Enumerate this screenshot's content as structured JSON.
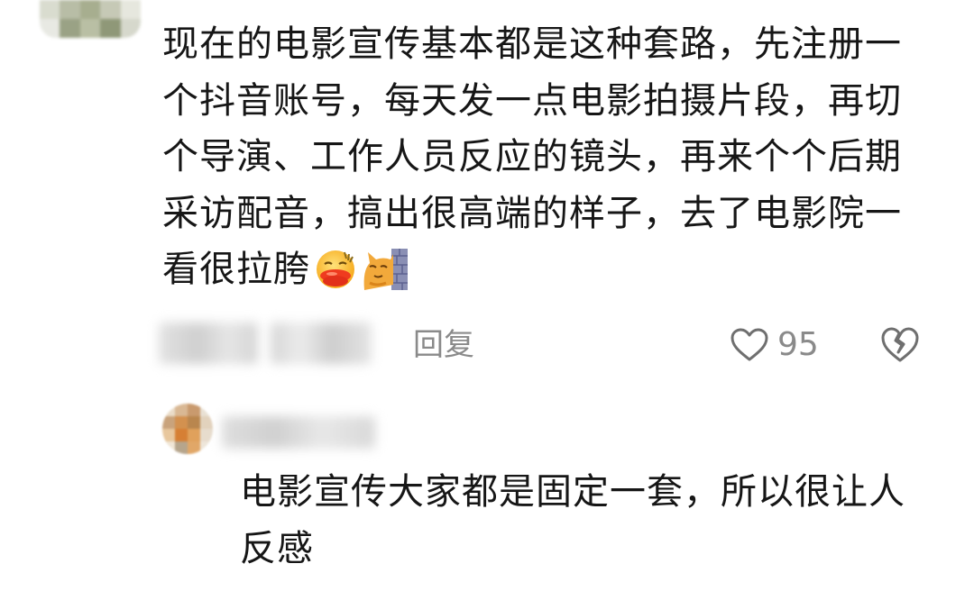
{
  "main_comment": {
    "text": "现在的电影宣传基本都是这种套路，先注册一个抖音账号，每天发一点电影拍摄片段，再切个导演、工作人员反应的镜头，再来个个后期采访配音，搞出很高端的样子，去了电影院一看很拉胯",
    "emojis": [
      "sweating-sausage-mouth-emoji",
      "cat-peeking-behind-wall-emoji"
    ],
    "reply_label": "回复",
    "like_count": "95"
  },
  "reply": {
    "text": "电影宣传大家都是固定一套，所以很让人反感"
  },
  "colors": {
    "text": "#161616",
    "meta": "#8a8a8a",
    "background": "#ffffff"
  }
}
